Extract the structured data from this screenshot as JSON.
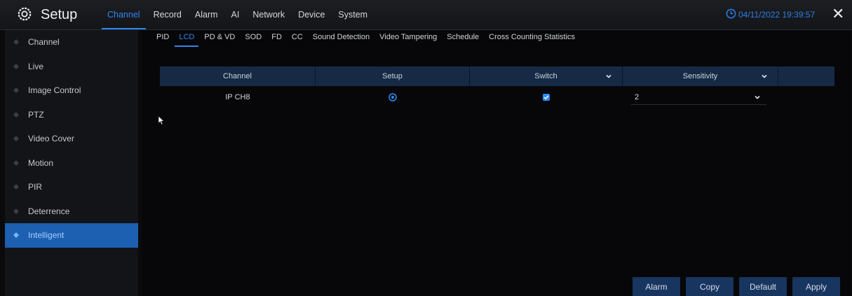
{
  "header": {
    "title": "Setup",
    "settings_icon": "gear-icon",
    "main_tabs": [
      "Channel",
      "Record",
      "Alarm",
      "AI",
      "Network",
      "Device",
      "System"
    ],
    "active_tab": "Channel",
    "datetime": "04/11/2022 19:39:57",
    "clock_icon": "clock-icon",
    "close_label": "✕"
  },
  "sidebar": {
    "items": [
      "Channel",
      "Live",
      "Image Control",
      "PTZ",
      "Video Cover",
      "Motion",
      "PIR",
      "Deterrence",
      "Intelligent"
    ],
    "active_item": "Intelligent"
  },
  "subnav": {
    "tabs": [
      "PID",
      "LCD",
      "PD & VD",
      "SOD",
      "FD",
      "CC",
      "Sound Detection",
      "Video Tampering",
      "Schedule",
      "Cross Counting Statistics"
    ],
    "active_tab": "LCD"
  },
  "table": {
    "columns": [
      "Channel",
      "Setup",
      "Switch",
      "Sensitivity"
    ],
    "rows": [
      {
        "channel": "IP CH8",
        "setup_icon": "settings-circle-icon",
        "switch_checked": true,
        "sensitivity": "2"
      }
    ]
  },
  "buttons": {
    "alarm": "Alarm",
    "copy": "Copy",
    "default": "Default",
    "apply": "Apply"
  },
  "colors": {
    "accent": "#2f86f0",
    "header_row": "#162a46",
    "button_bg": "#17355f",
    "sidebar_active": "#1d5fb0"
  }
}
